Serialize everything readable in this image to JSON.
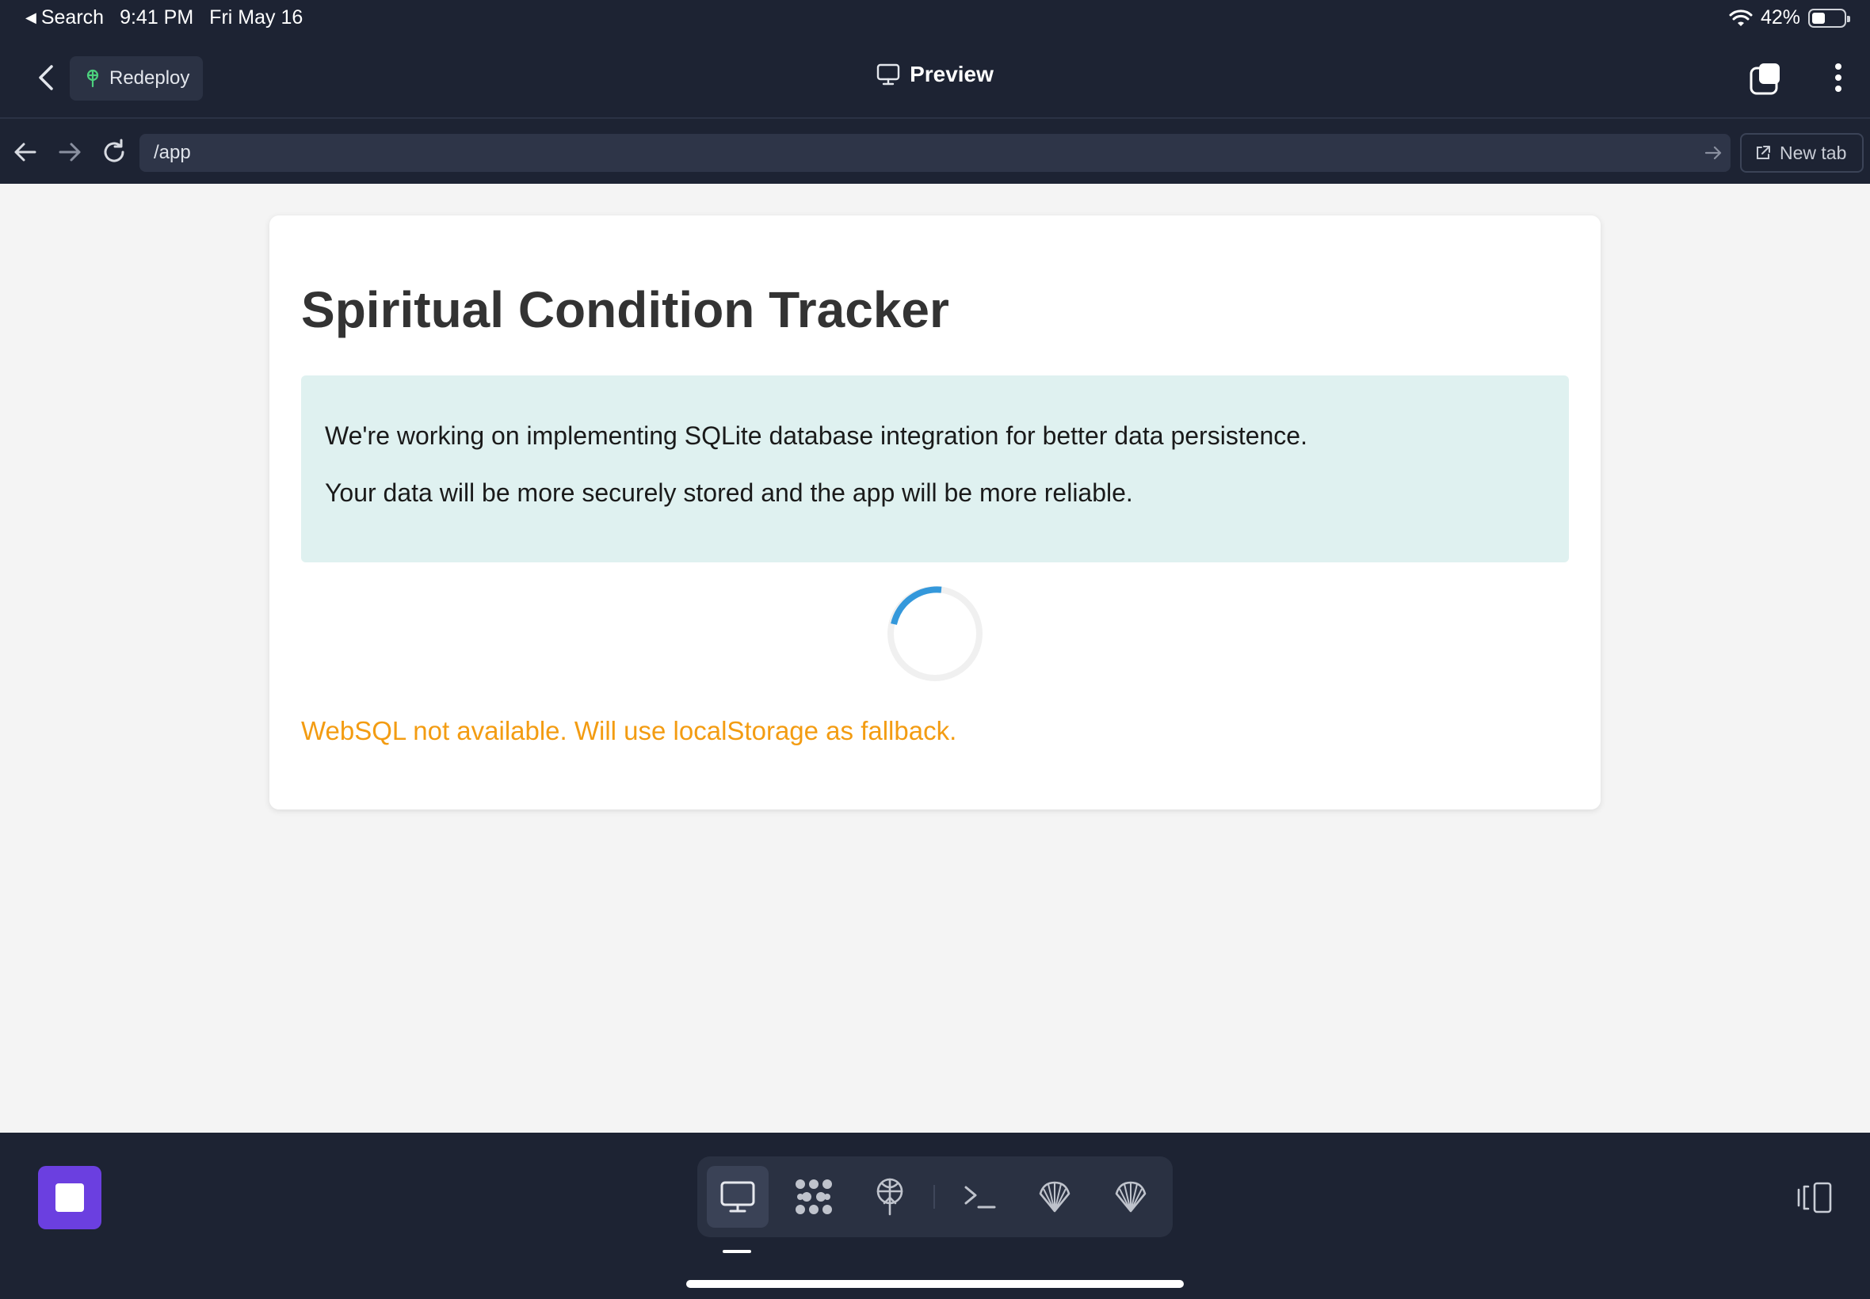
{
  "status_bar": {
    "back_app": "Search",
    "time": "9:41 PM",
    "date": "Fri May 16",
    "battery": "42%",
    "battery_level": 0.42
  },
  "header": {
    "redeploy_label": "Redeploy",
    "title": "Preview",
    "icons": [
      "chevron-left-icon",
      "redeploy-icon",
      "monitor-icon",
      "tabs-icon",
      "more-vertical-icon"
    ]
  },
  "address_bar": {
    "url": "/app",
    "new_tab_label": "New tab"
  },
  "page": {
    "title": "Spiritual Condition Tracker",
    "info_lines": [
      "We're working on implementing SQLite database integration for better data persistence.",
      "Your data will be more securely stored and the app will be more reliable."
    ],
    "warning": "WebSQL not available. Will use localStorage as fallback.",
    "warning_color": "#f39c12",
    "info_bg": "#dff1f0"
  },
  "dock": {
    "stop_color": "#6b3fe0",
    "tools": [
      "preview-icon",
      "packages-icon",
      "deploy-icon",
      "terminal-icon",
      "shell-icon",
      "shell-icon-2"
    ]
  }
}
